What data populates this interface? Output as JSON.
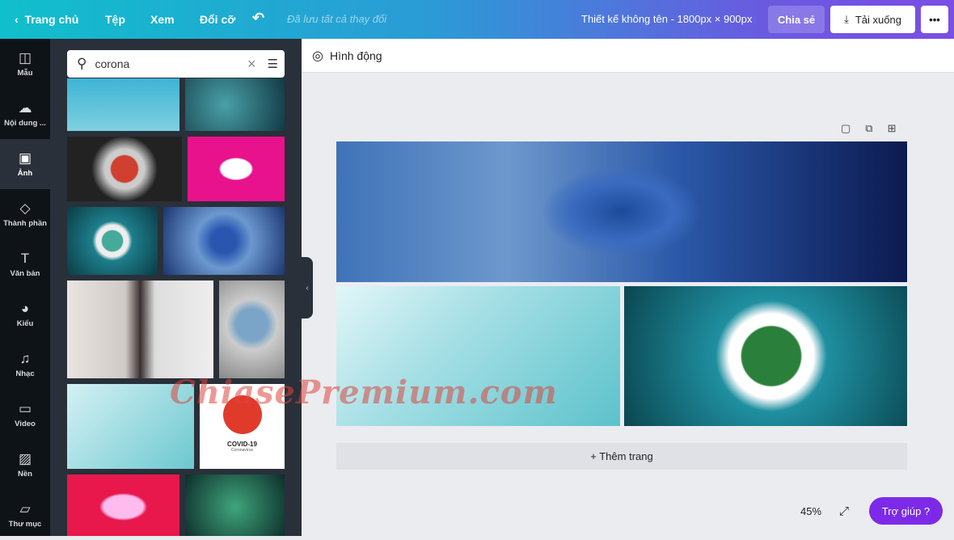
{
  "topbar": {
    "home": "Trang chủ",
    "file": "Tệp",
    "view": "Xem",
    "resize": "Đổi cỡ",
    "saved_status": "Đã lưu tất cả thay đổi",
    "design_title": "Thiết kế không tên - 1800px × 900px",
    "share": "Chia sẻ",
    "download": "Tải xuống",
    "more": "•••"
  },
  "sidebar": {
    "items": [
      {
        "label": "Mẫu",
        "icon": "template-icon"
      },
      {
        "label": "Nội dung ...",
        "icon": "upload-icon"
      },
      {
        "label": "Ảnh",
        "icon": "photo-icon"
      },
      {
        "label": "Thành phần",
        "icon": "elements-icon"
      },
      {
        "label": "Văn bản",
        "icon": "text-icon"
      },
      {
        "label": "Kiểu",
        "icon": "palette-icon"
      },
      {
        "label": "Nhạc",
        "icon": "music-icon"
      },
      {
        "label": "Video",
        "icon": "video-icon"
      },
      {
        "label": "Nền",
        "icon": "background-icon"
      },
      {
        "label": "Thư mục",
        "icon": "folder-icon"
      }
    ]
  },
  "search": {
    "value": "corona"
  },
  "thumb_text": {
    "covid": "COVID-19",
    "covid_sub": "Coronavirus"
  },
  "toolbar": {
    "animate": "Hình động"
  },
  "canvas": {
    "add_page": "+ Thêm trang",
    "zoom": "45%",
    "help": "Trợ giúp  ?"
  },
  "watermark": "ChiasePremium.com"
}
